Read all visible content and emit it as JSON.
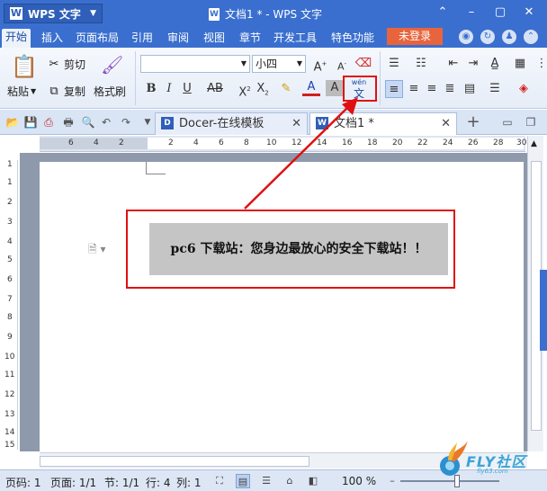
{
  "titlebar": {
    "app_label": "WPS 文字",
    "doc_title": "文档1 * - WPS 文字",
    "minimize": "⌃",
    "restore": "–",
    "maximize": "▢",
    "close": "✕"
  },
  "menu": {
    "tabs": [
      "开始",
      "插入",
      "页面布局",
      "引用",
      "审阅",
      "视图",
      "章节",
      "开发工具",
      "特色功能"
    ],
    "login": "未登录"
  },
  "ribbon": {
    "paste": "粘贴",
    "cut": "剪切",
    "copy": "复制",
    "format_painter": "格式刷",
    "font_name": "",
    "font_size": "小四",
    "phonetic_top": "wén",
    "phonetic_bottom": "文"
  },
  "tabs": {
    "docer": "Docer-在线模板",
    "doc": "文档1 *",
    "new": "+"
  },
  "ruler": {
    "h_numbers": [
      "6",
      "4",
      "2",
      "2",
      "4",
      "6",
      "8",
      "10",
      "12",
      "14",
      "16",
      "18",
      "20",
      "22",
      "24",
      "26",
      "28",
      "30"
    ],
    "v_numbers": [
      "1",
      "1",
      "2",
      "3",
      "4",
      "5",
      "6",
      "7",
      "8",
      "9",
      "10",
      "11",
      "12",
      "13",
      "14",
      "15"
    ]
  },
  "document": {
    "highlight_text": "pc6 下载站：您身边最放心的安全下载站！！"
  },
  "status": {
    "page_no": "页码: 1",
    "pages": "页面: 1/1",
    "section": "节: 1/1",
    "row": "行: 4",
    "col": "列: 1",
    "zoom": "100 %"
  },
  "watermark": {
    "text": "FLY社区",
    "sub": "fly63.com"
  },
  "colors": {
    "brand": "#3a6fcf",
    "annotation": "#e01010",
    "login": "#e8643c"
  }
}
